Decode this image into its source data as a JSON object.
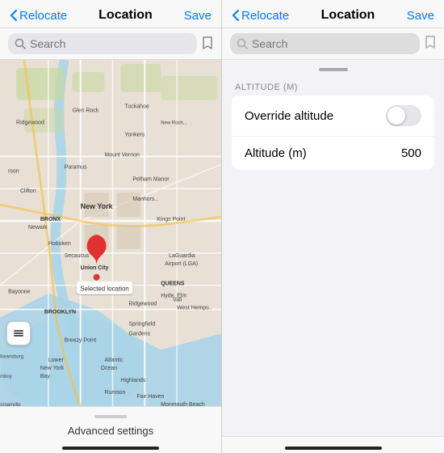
{
  "left": {
    "nav": {
      "back_label": "Relocate",
      "title": "Location",
      "action_label": "Save"
    },
    "search": {
      "placeholder": "Search",
      "bookmark_icon": "bookmark"
    },
    "map": {
      "selected_location_label": "Selected location",
      "pin_color": "#e03030"
    },
    "bottom": {
      "label": "Advanced settings",
      "handle_visible": true
    }
  },
  "right": {
    "nav": {
      "back_label": "Relocate",
      "title": "Location",
      "action_label": "Save"
    },
    "search": {
      "placeholder": "Search",
      "bookmark_icon": "bookmark"
    },
    "altitude_section": {
      "header": "ALTITUDE (M)",
      "override_label": "Override altitude",
      "override_enabled": false,
      "altitude_label": "Altitude (m)",
      "altitude_value": "500"
    }
  },
  "colors": {
    "accent": "#007AFF",
    "pin": "#e03030",
    "toggle_off": "#e5e5ea",
    "toggle_on": "#34C759"
  }
}
